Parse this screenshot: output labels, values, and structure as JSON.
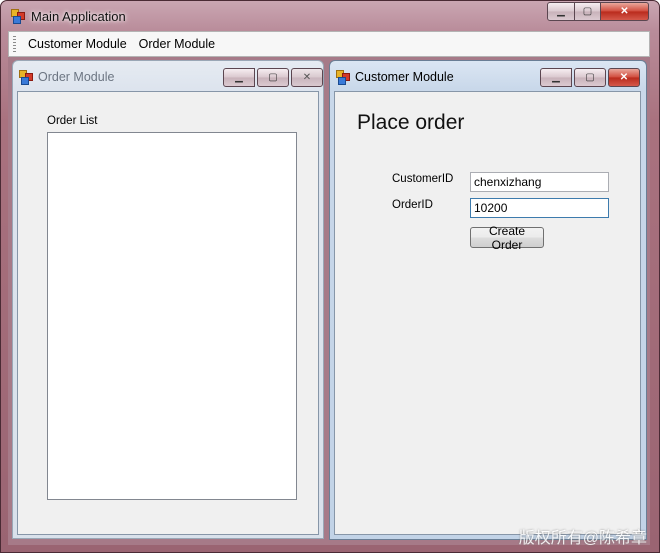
{
  "main_window": {
    "title": "Main Application",
    "controls": {
      "minimize": "▁",
      "maximize": "▢",
      "close": "✕"
    }
  },
  "menu": {
    "items": [
      "Customer Module",
      "Order Module"
    ]
  },
  "order_module": {
    "title": "Order Module",
    "list_label": "Order List",
    "orders": [],
    "controls": {
      "minimize": "▁",
      "maximize": "▢",
      "close": "✕"
    }
  },
  "customer_module": {
    "title": "Customer Module",
    "heading": "Place order",
    "customer_id_label": "CustomerID",
    "customer_id_value": "chenxizhang",
    "order_id_label": "OrderID",
    "order_id_value": "10200",
    "create_button": "Create Order",
    "controls": {
      "minimize": "▁",
      "maximize": "▢",
      "close": "✕"
    }
  },
  "watermark": "版权所有@陈希章"
}
